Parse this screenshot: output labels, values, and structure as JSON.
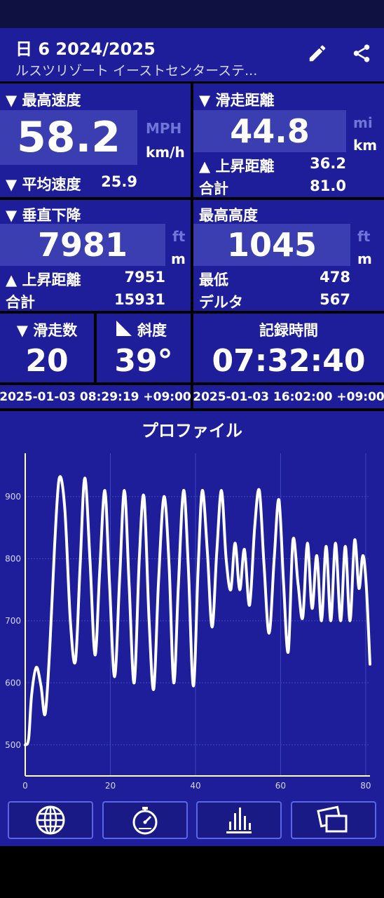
{
  "header": {
    "title": "日 6 2024/2025",
    "subtitle": "ルスツリゾート イーストセンターステ..."
  },
  "max_speed": {
    "label": "▼ 最高速度",
    "value": "58.2",
    "unit_alt": "MPH",
    "unit": "km/h",
    "avg_label": "▼ 平均速度",
    "avg_value": "25.9"
  },
  "ski_distance": {
    "label": "▼ 滑走距離",
    "value": "44.8",
    "unit_alt": "mi",
    "unit": "km",
    "ascent_label": "▲ 上昇距離",
    "ascent_value": "36.2",
    "total_label": "合計",
    "total_value": "81.0"
  },
  "vertical_descent": {
    "label": "▼ 垂直下降",
    "value": "7981",
    "unit_alt": "ft",
    "unit": "m",
    "ascent_label": "▲ 上昇距離",
    "ascent_value": "7951",
    "total_label": "合計",
    "total_value": "15931"
  },
  "max_altitude": {
    "label": "最高高度",
    "value": "1045",
    "unit_alt": "ft",
    "unit": "m",
    "min_label": "最低",
    "min_value": "478",
    "delta_label": "デルタ",
    "delta_value": "567"
  },
  "runs": {
    "label": "▼ 滑走数",
    "value": "20"
  },
  "slope": {
    "label": "斜度",
    "value": "39°"
  },
  "record_time": {
    "label": "記録時間",
    "value": "07:32:40"
  },
  "start_time": "2025-01-03 08:29:19 +09:00",
  "end_time": "2025-01-03 16:02:00 +09:00",
  "chart_title": "プロファイル",
  "chart_data": {
    "type": "line",
    "title": "プロファイル",
    "xlabel": "",
    "ylabel": "",
    "xlim": [
      0,
      81
    ],
    "ylim": [
      450,
      970
    ],
    "xticks": [
      0,
      20,
      40,
      60,
      80
    ],
    "yticks": [
      500,
      600,
      700,
      800,
      900
    ],
    "grid": true,
    "series": [
      {
        "color": "#ffffff",
        "x": [
          0,
          0.8,
          1.5,
          2.6,
          3.7,
          4.7,
          5.8,
          6.9,
          8.0,
          9.3,
          10.6,
          11.8,
          12.9,
          14.0,
          15.2,
          16.4,
          17.5,
          18.7,
          19.8,
          21.0,
          22.2,
          23.3,
          24.4,
          25.6,
          26.8,
          27.9,
          29.1,
          30.2,
          31.3,
          32.6,
          33.8,
          34.9,
          36.0,
          37.2,
          38.3,
          39.5,
          40.6,
          41.6,
          42.8,
          43.9,
          45.0,
          46.1,
          47.2,
          48.3,
          49.3,
          50.4,
          51.5,
          52.7,
          53.9,
          55.0,
          56.1,
          57.3,
          58.5,
          59.6,
          60.7,
          61.8,
          62.9,
          64.1,
          65.2,
          66.3,
          67.4,
          68.5,
          69.6,
          70.7,
          71.8,
          72.9,
          74.1,
          75.2,
          76.3,
          77.4,
          78.4,
          79.3,
          80.1,
          81.0
        ],
        "y": [
          500,
          510,
          580,
          625,
          595,
          550,
          660,
          820,
          930,
          880,
          700,
          635,
          790,
          930,
          800,
          645,
          780,
          910,
          760,
          610,
          770,
          910,
          760,
          600,
          800,
          900,
          700,
          590,
          760,
          900,
          790,
          600,
          760,
          910,
          790,
          595,
          780,
          910,
          810,
          690,
          810,
          910,
          800,
          750,
          825,
          750,
          815,
          725,
          850,
          910,
          790,
          680,
          800,
          895,
          760,
          650,
          830,
          760,
          705,
          825,
          720,
          805,
          700,
          820,
          700,
          825,
          700,
          820,
          700,
          830,
          752,
          805,
          760,
          630
        ]
      }
    ]
  }
}
